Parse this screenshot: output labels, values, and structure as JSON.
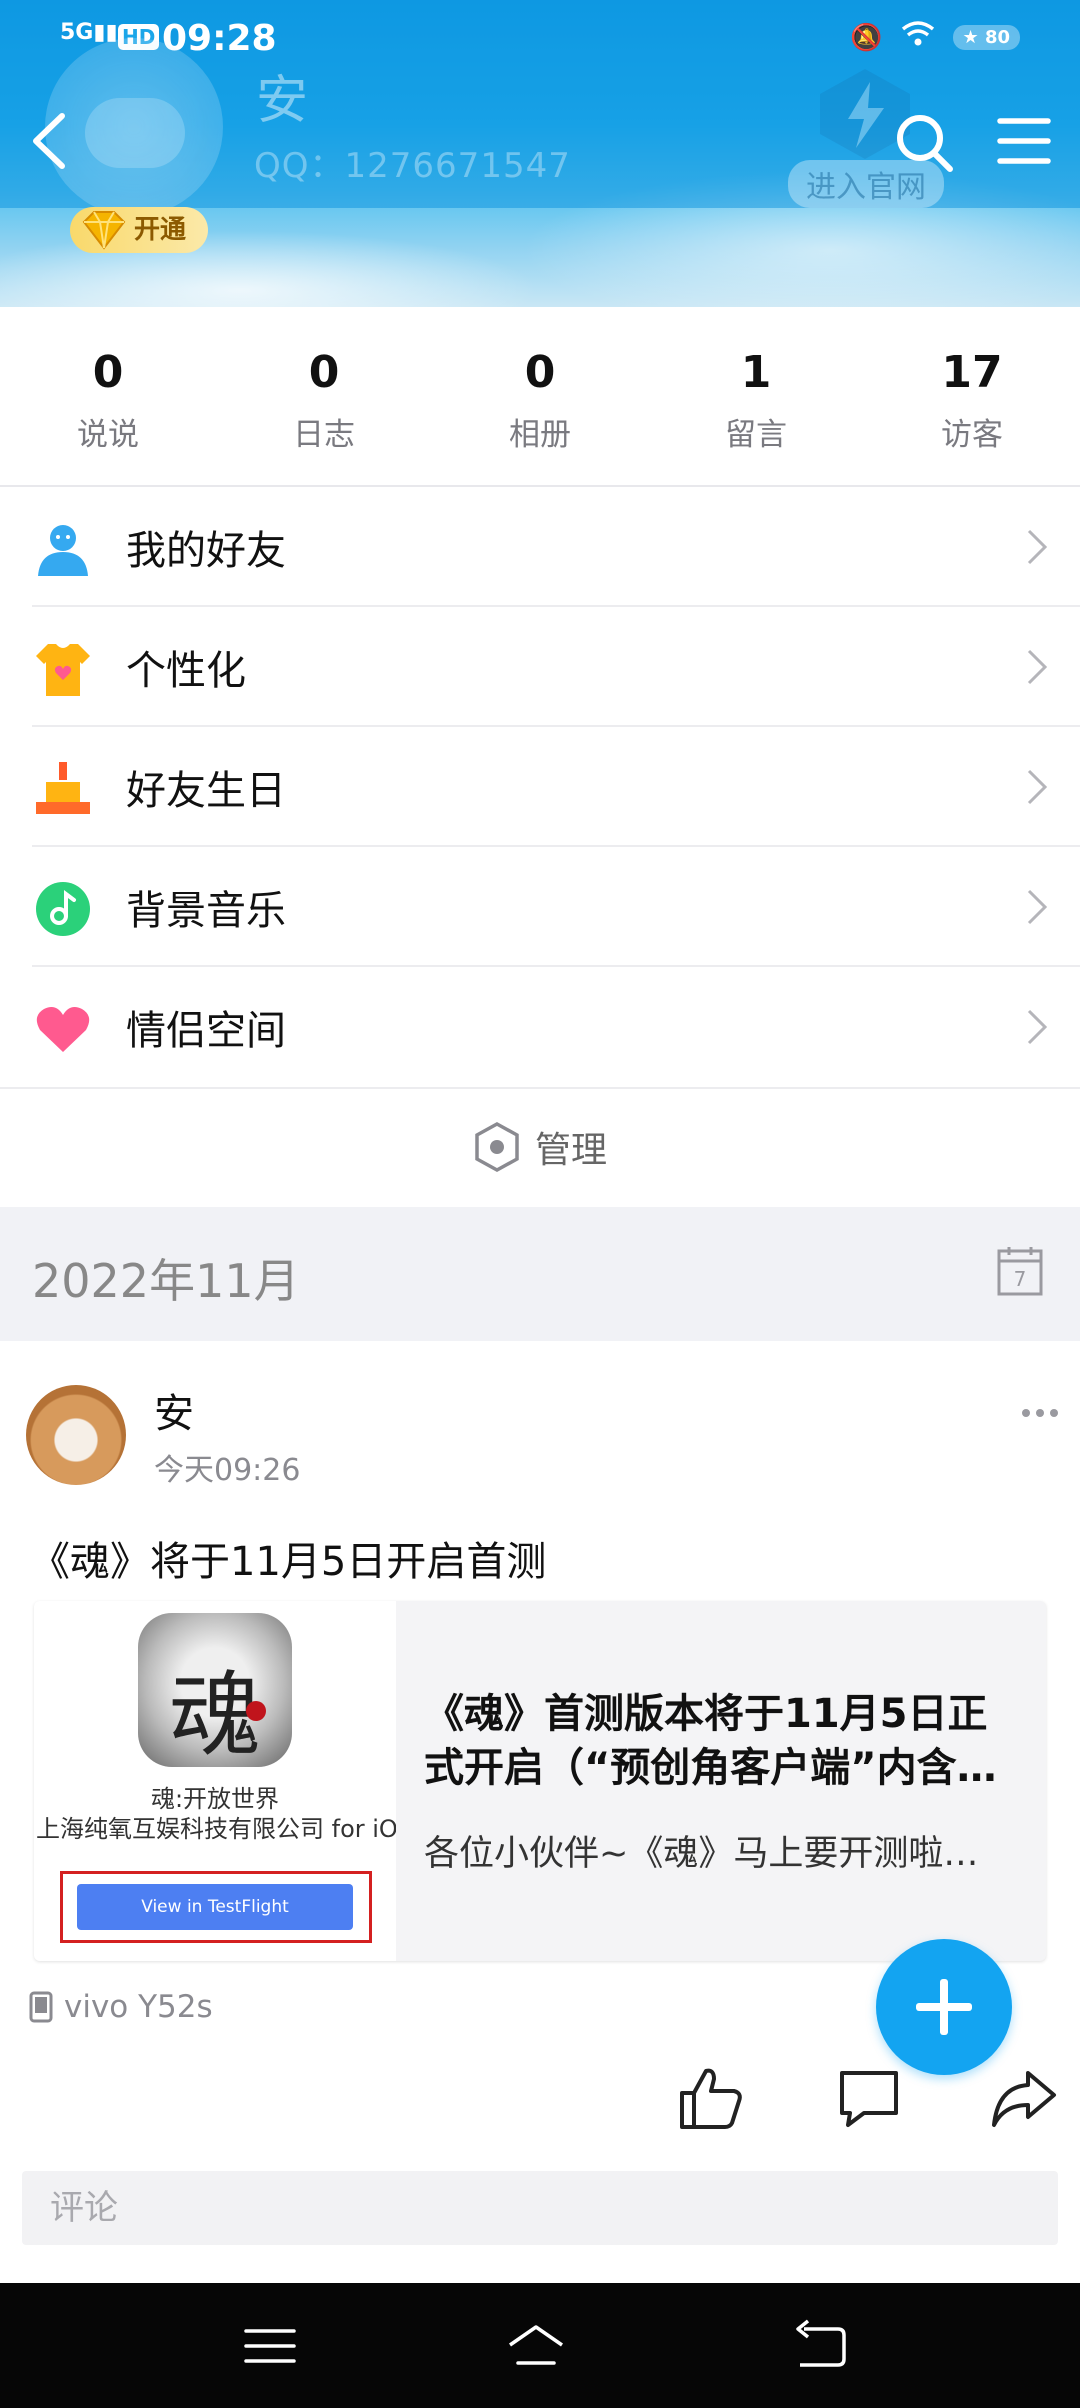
{
  "status_bar": {
    "network": "5G",
    "hd": "HD",
    "time": "09:28",
    "battery": "80"
  },
  "header": {
    "name": "安",
    "qq": "QQ：1276671547",
    "official_site": "进入官网",
    "vip_label": "开通",
    "bg_color": "#1aa3e8"
  },
  "stats": [
    {
      "value": "0",
      "label": "说说"
    },
    {
      "value": "0",
      "label": "日志"
    },
    {
      "value": "0",
      "label": "相册"
    },
    {
      "value": "1",
      "label": "留言"
    },
    {
      "value": "17",
      "label": "访客"
    }
  ],
  "menu": [
    {
      "label": "我的好友",
      "icon": "friends-icon",
      "color": "#35a9f0"
    },
    {
      "label": "个性化",
      "icon": "tshirt-icon",
      "color": "#ffb412"
    },
    {
      "label": "好友生日",
      "icon": "birthday-cake-icon",
      "color": "#ffb412"
    },
    {
      "label": "背景音乐",
      "icon": "music-icon",
      "color": "#2bd17a"
    },
    {
      "label": "情侣空间",
      "icon": "heart-icon",
      "color": "#ff5a8f"
    }
  ],
  "manage_label": "管理",
  "month": "2022年11月",
  "calendar_day": "7",
  "post": {
    "author": "安",
    "time": "今天09:26",
    "text": "《魂》将于11月5日开启首测",
    "card": {
      "app_glyph": "魂",
      "app_name": "魂:开放世界",
      "developer": "上海纯氧互娱科技有限公司 for iOS",
      "button": "View in TestFlight",
      "title": "《魂》首测版本将于11月5日正式开启（“预创角客户端”内含…",
      "desc": "各位小伙伴~《魂》马上要开测啦…"
    },
    "device": "vivo Y52s",
    "comment_placeholder": "评论"
  },
  "colors": {
    "accent": "#13a4f1",
    "testflight_blue": "#4d7ff2",
    "highlight_red": "#d42020"
  }
}
